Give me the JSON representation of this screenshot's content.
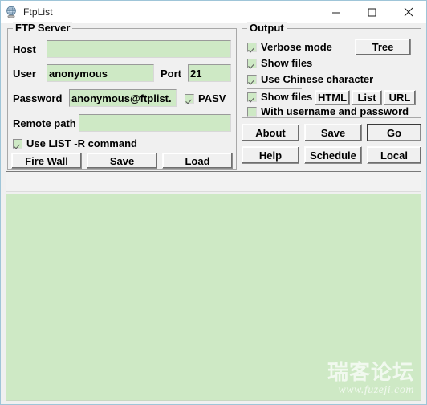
{
  "window": {
    "title": "FtpList",
    "icon": "globe-icon",
    "controls": {
      "minimize": "minimize-icon",
      "maximize": "maximize-icon",
      "close": "close-icon"
    }
  },
  "ftp_server": {
    "group_title": "FTP Server",
    "host_label": "Host",
    "host_value": "",
    "host_placeholder": "",
    "user_label": "User",
    "user_value": "anonymous",
    "port_label": "Port",
    "port_value": "21",
    "password_label": "Password",
    "password_value": "anonymous@ftplist.",
    "pasv_label": "PASV",
    "pasv_checked": true,
    "remote_path_label": "Remote path",
    "remote_path_value": "",
    "list_r_label": "Use LIST -R command",
    "list_r_checked": true,
    "buttons": {
      "firewall": "Fire Wall",
      "save": "Save",
      "load": "Load"
    }
  },
  "output": {
    "group_title": "Output",
    "verbose_label": "Verbose mode",
    "verbose_checked": true,
    "show_files_label": "Show files",
    "show_files_checked": true,
    "chinese_label": "Use Chinese character",
    "chinese_checked": true,
    "show_files2_label": "Show files",
    "show_files2_checked": true,
    "with_credentials_label": "With username and password",
    "with_credentials_checked": false,
    "tree_button": "Tree",
    "html_button": "HTML",
    "list_button": "List",
    "url_button": "URL"
  },
  "actions": {
    "about": "About",
    "save": "Save",
    "go": "Go",
    "help": "Help",
    "schedule": "Schedule",
    "local": "Local"
  },
  "panes": {
    "status_text": "",
    "log_text": ""
  },
  "watermark": {
    "chinese": "瑞客论坛",
    "url": "www.fuzeji.com"
  },
  "colors": {
    "field_green": "#cee9c5",
    "window_bg": "#f0f0f0",
    "titlebar_bg": "#ffffff",
    "border_gray": "#a8a8a8"
  }
}
